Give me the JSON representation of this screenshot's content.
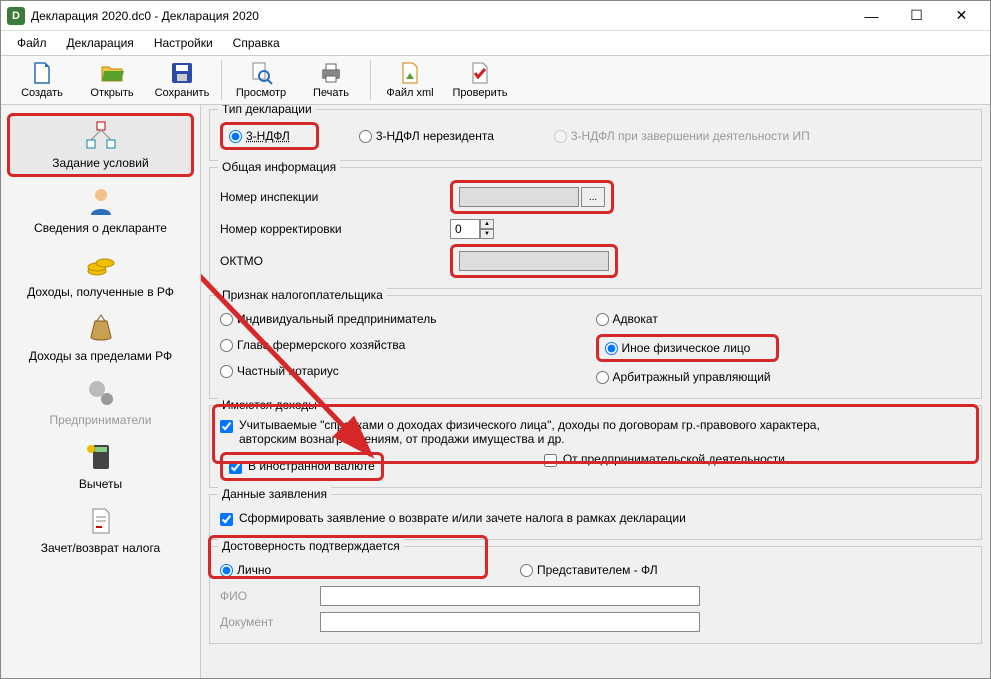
{
  "window": {
    "title": "Декларация 2020.dc0 - Декларация 2020",
    "icon_letter": "D"
  },
  "winControls": {
    "min": "—",
    "max": "☐",
    "close": "✕"
  },
  "menu": {
    "file": "Файл",
    "decl": "Декларация",
    "settings": "Настройки",
    "help": "Справка"
  },
  "toolbar": {
    "create": "Создать",
    "open": "Открыть",
    "save": "Сохранить",
    "view": "Просмотр",
    "print": "Печать",
    "xml": "Файл xml",
    "check": "Проверить"
  },
  "nav": {
    "conditions": "Задание условий",
    "declarant": "Сведения о декларанте",
    "income_rf": "Доходы, полученные в РФ",
    "income_abroad": "Доходы за пределами РФ",
    "entrepreneurs": "Предприниматели",
    "deductions": "Вычеты",
    "offset": "Зачет/возврат налога"
  },
  "decl_type": {
    "legend": "Тип декларации",
    "r1": "3-НДФЛ",
    "r2": "3-НДФЛ нерезидента",
    "r3": "3-НДФЛ при завершении деятельности ИП"
  },
  "general": {
    "legend": "Общая информация",
    "inspection": "Номер инспекции",
    "inspection_val": "",
    "correction": "Номер корректировки",
    "correction_val": "0",
    "oktmo": "ОКТМО",
    "oktmo_val": "",
    "browse": "..."
  },
  "taxpayer": {
    "legend": "Признак налогоплательщика",
    "r1": "Индивидуальный предприниматель",
    "r2": "Глава фермерского хозяйства",
    "r3": "Частный нотариус",
    "r4": "Адвокат",
    "r5": "Иное физическое лицо",
    "r6": "Арбитражный управляющий"
  },
  "income": {
    "legend": "Имеются доходы",
    "c1": "Учитываемые \"справками о доходах физического лица\", доходы по договорам гр.-правового характера, авторским вознаграждениям, от продажи имущества и др.",
    "c2": "В иностранной валюте",
    "c3": "От предпринимательской деятельности"
  },
  "application": {
    "legend": "Данные заявления",
    "c1": "Сформировать заявление о  возврате и/или зачете налога в рамках декларации"
  },
  "confirm": {
    "legend": "Достоверность подтверждается",
    "r1": "Лично",
    "r2": "Представителем - ФЛ",
    "fio": "ФИО",
    "doc": "Документ"
  }
}
